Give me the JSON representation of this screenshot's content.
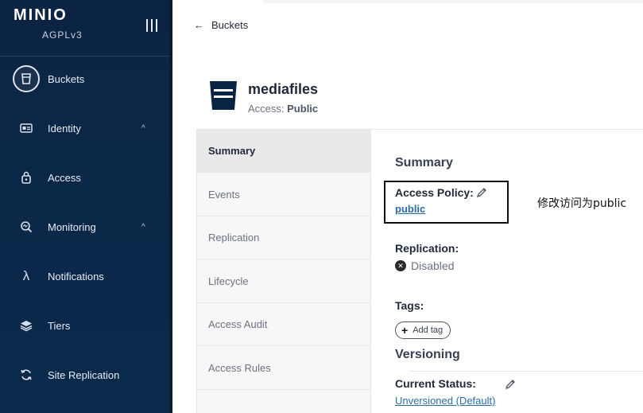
{
  "sidebar": {
    "logo": "MINIO",
    "license": "AGPLv3",
    "items": [
      {
        "label": "Buckets",
        "icon": "bucket-icon"
      },
      {
        "label": "Identity",
        "icon": "identity-card-icon",
        "chevron": "^"
      },
      {
        "label": "Access",
        "icon": "lock-icon"
      },
      {
        "label": "Monitoring",
        "icon": "monitor-search-icon",
        "chevron": "^"
      },
      {
        "label": "Notifications",
        "icon": "lambda-icon"
      },
      {
        "label": "Tiers",
        "icon": "layers-icon"
      },
      {
        "label": "Site Replication",
        "icon": "sync-icon"
      }
    ]
  },
  "header": {
    "back_label": "Buckets"
  },
  "bucket": {
    "name": "mediafiles",
    "access_prefix": "Access:",
    "access_value": "Public"
  },
  "tabs": [
    "Summary",
    "Events",
    "Replication",
    "Lifecycle",
    "Access Audit",
    "Access Rules"
  ],
  "summary": {
    "title": "Summary",
    "access_policy_label": "Access Policy:",
    "access_policy_value": "public",
    "replication_label": "Replication:",
    "replication_value": "Disabled",
    "tags_label": "Tags:",
    "add_tag_label": "Add tag",
    "versioning_title": "Versioning",
    "current_status_label": "Current Status:",
    "current_status_value": "Unversioned (Default)"
  },
  "annotation": "修改访问为public",
  "colors": {
    "sidebar": "#0c2443",
    "link": "#2b6ea6",
    "active_tab": "#e9e9eb"
  }
}
